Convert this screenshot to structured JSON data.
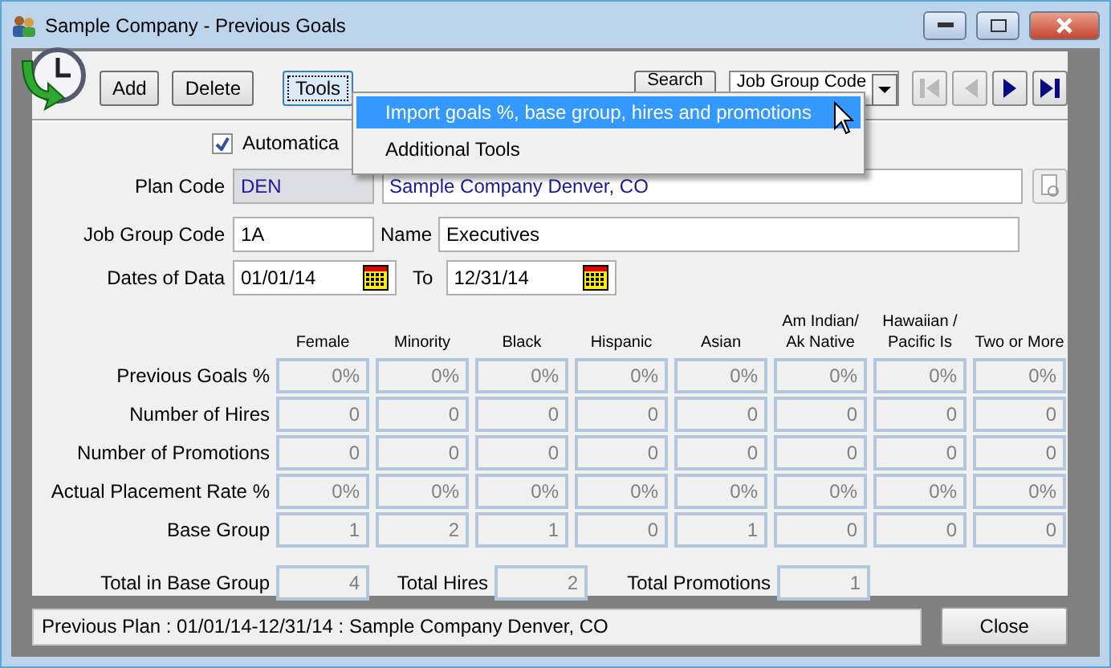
{
  "window": {
    "title": "Sample Company - Previous Goals"
  },
  "toolbar": {
    "buttons": [
      {
        "label": "Add",
        "focused": false
      },
      {
        "label": "Delete",
        "focused": false
      },
      {
        "label": "Tools",
        "focused": true
      }
    ],
    "search_button": "Search",
    "search_field": {
      "value": "Job Group Code"
    },
    "nav_buttons": [
      {
        "kind": "first",
        "disabled": true
      },
      {
        "kind": "prev",
        "disabled": true
      },
      {
        "kind": "next",
        "disabled": false
      },
      {
        "kind": "last",
        "disabled": false
      }
    ]
  },
  "tools_menu": [
    {
      "label": "Import goals %, base group, hires and promotions",
      "selected": true
    },
    {
      "label": "Additional Tools",
      "selected": false
    }
  ],
  "automatic": {
    "label": "Automatica",
    "checked": true
  },
  "plan_code": {
    "label": "Plan Code",
    "value": "DEN",
    "name": "Sample Company Denver, CO"
  },
  "job_group": {
    "label": "Job Group Code",
    "value": "1A",
    "name_label": "Name",
    "name": "Executives"
  },
  "dates": {
    "label": "Dates of Data",
    "from": "01/01/14",
    "to_label": "To",
    "to": "12/31/14"
  },
  "columns": [
    "Female",
    "Minority",
    "Black",
    "Hispanic",
    "Asian",
    "Am Indian/ Ak Native",
    "Hawaiian / Pacific Is",
    "Two or More"
  ],
  "rows": [
    {
      "label": "Previous Goals %",
      "values": [
        "0%",
        "0%",
        "0%",
        "0%",
        "0%",
        "0%",
        "0%",
        "0%"
      ]
    },
    {
      "label": "Number of Hires",
      "values": [
        "0",
        "0",
        "0",
        "0",
        "0",
        "0",
        "0",
        "0"
      ]
    },
    {
      "label": "Number of Promotions",
      "values": [
        "0",
        "0",
        "0",
        "0",
        "0",
        "0",
        "0",
        "0"
      ]
    },
    {
      "label": "Actual Placement Rate %",
      "values": [
        "0%",
        "0%",
        "0%",
        "0%",
        "0%",
        "0%",
        "0%",
        "0%"
      ]
    },
    {
      "label": "Base Group",
      "values": [
        "1",
        "2",
        "1",
        "0",
        "1",
        "0",
        "0",
        "0"
      ]
    }
  ],
  "totals": [
    {
      "label": "Total in Base Group",
      "value": "4"
    },
    {
      "label": "Total Hires",
      "value": "2"
    },
    {
      "label": "Total Promotions",
      "value": "1"
    }
  ],
  "status_bar": "Previous Plan : 01/01/14-12/31/14 : Sample Company Denver, CO",
  "close_button": "Close"
}
